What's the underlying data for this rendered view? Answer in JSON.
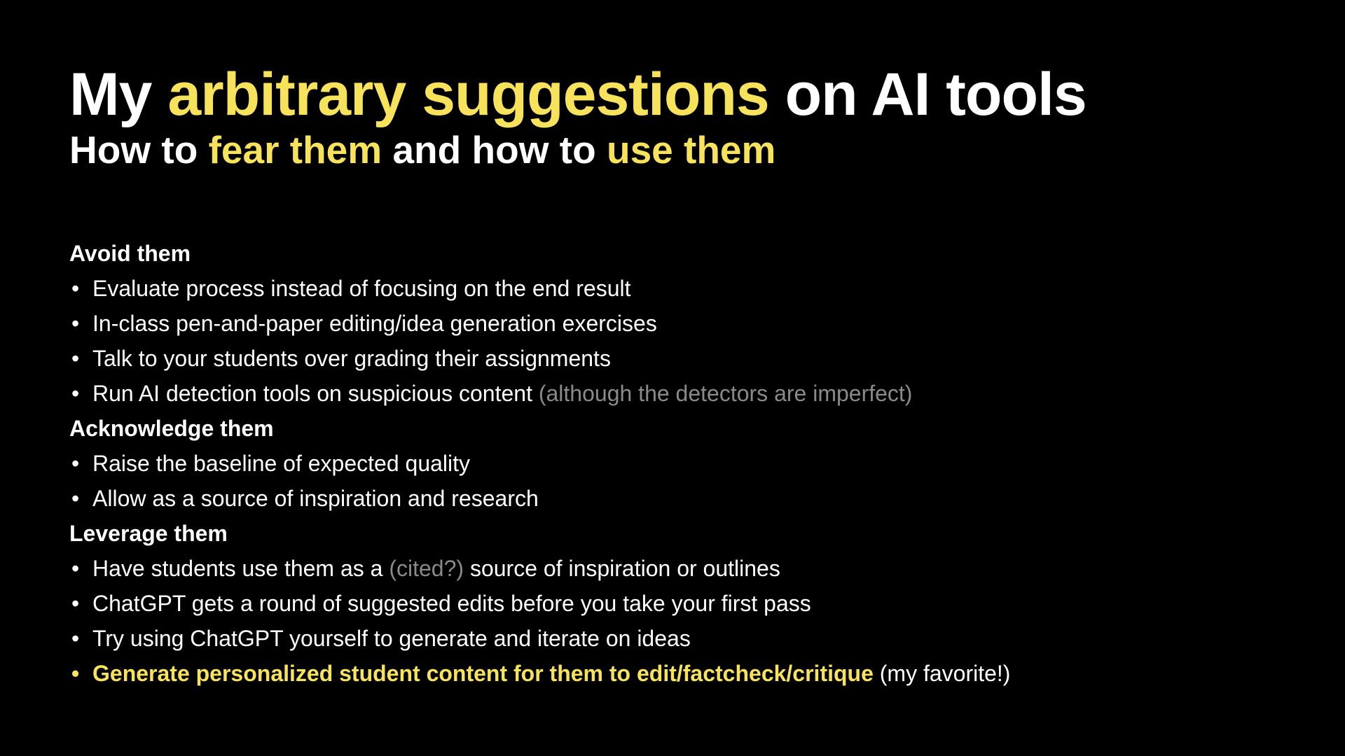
{
  "title": {
    "part1": "My ",
    "highlight": "arbitrary suggestions",
    "part2": " on AI tools"
  },
  "subtitle": {
    "part1": "How to ",
    "highlight1": "fear them",
    "part2": " and how to ",
    "highlight2": "use them"
  },
  "colors": {
    "background": "#000000",
    "text": "#ffffff",
    "highlight": "#f6e25b",
    "muted": "#8a8a8a"
  },
  "sections": [
    {
      "heading": "Avoid them",
      "items": [
        {
          "text": "Evaluate process instead of focusing on the end result"
        },
        {
          "text": "In-class pen-and-paper editing/idea generation exercises"
        },
        {
          "text": "Talk to your students over grading their assignments"
        },
        {
          "text": "Run AI detection tools on suspicious content ",
          "note": "(although the detectors are imperfect)"
        }
      ]
    },
    {
      "heading": "Acknowledge them",
      "items": [
        {
          "text": "Raise the baseline of expected quality"
        },
        {
          "text": "Allow as a source of inspiration and research"
        }
      ]
    },
    {
      "heading": "Leverage them",
      "items": [
        {
          "text": "Have students use them as a ",
          "note": "(cited?)",
          "text2": " source of inspiration or outlines"
        },
        {
          "text": "ChatGPT gets a round of suggested edits before you take your first pass"
        },
        {
          "text": "Try using ChatGPT yourself to generate and iterate on ideas"
        },
        {
          "text": "Generate personalized student content for them to edit/factcheck/critique",
          "text2": " (my favorite!)"
        }
      ]
    }
  ],
  "bullet_char": "•"
}
